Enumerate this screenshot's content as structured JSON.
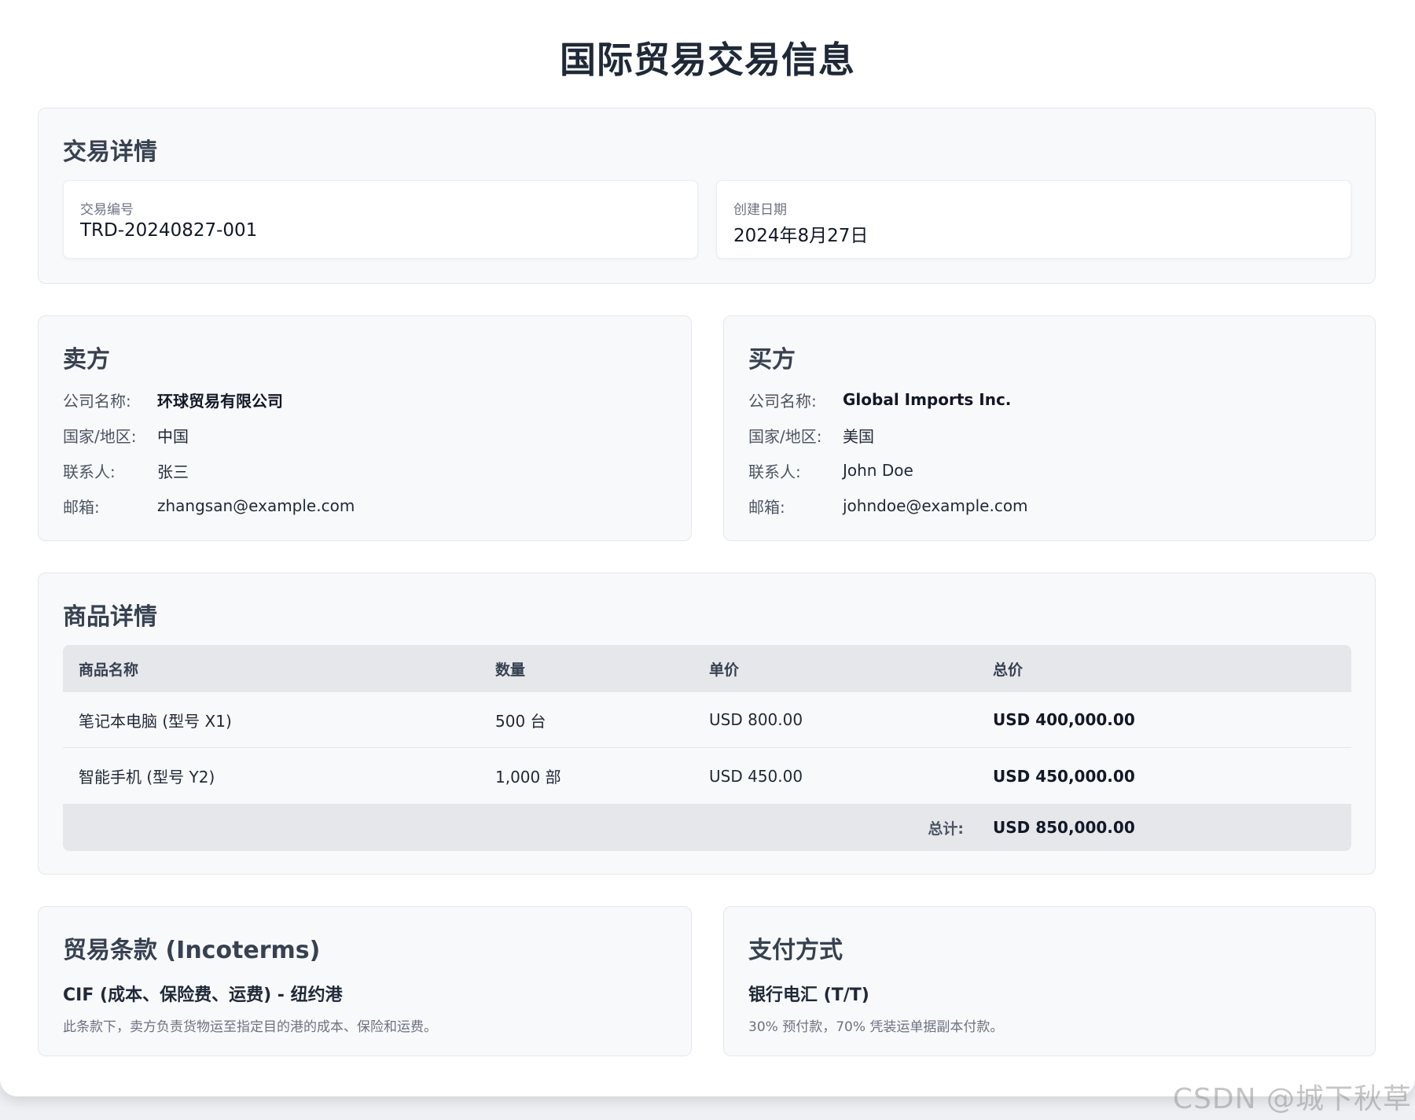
{
  "page_title": "国际贸易交易信息",
  "transaction": {
    "section_title": "交易详情",
    "id_label": "交易编号",
    "id_value": "TRD-20240827-001",
    "date_label": "创建日期",
    "date_value": "2024年8月27日"
  },
  "seller": {
    "section_title": "卖方",
    "rows": [
      {
        "label": "公司名称:",
        "value": "环球贸易有限公司"
      },
      {
        "label": "国家/地区:",
        "value": "中国"
      },
      {
        "label": "联系人:",
        "value": "张三"
      },
      {
        "label": "邮箱:",
        "value": "zhangsan@example.com"
      }
    ]
  },
  "buyer": {
    "section_title": "买方",
    "rows": [
      {
        "label": "公司名称:",
        "value": "Global Imports Inc."
      },
      {
        "label": "国家/地区:",
        "value": "美国"
      },
      {
        "label": "联系人:",
        "value": "John Doe"
      },
      {
        "label": "邮箱:",
        "value": "johndoe@example.com"
      }
    ]
  },
  "products": {
    "section_title": "商品详情",
    "columns": [
      "商品名称",
      "数量",
      "单价",
      "总价"
    ],
    "rows": [
      [
        "笔记本电脑 (型号 X1)",
        "500 台",
        "USD 800.00",
        "USD 400,000.00"
      ],
      [
        "智能手机 (型号 Y2)",
        "1,000 部",
        "USD 450.00",
        "USD 450,000.00"
      ]
    ],
    "total_label": "总计:",
    "total_value": "USD 850,000.00"
  },
  "terms": {
    "section_title": "贸易条款 (Incoterms)",
    "main": "CIF (成本、保险费、运费) - 纽约港",
    "description": "此条款下，卖方负责货物运至指定目的港的成本、保险和运费。"
  },
  "payment": {
    "section_title": "支付方式",
    "main": "银行电汇 (T/T)",
    "description": "30% 预付款，70% 凭装运单据副本付款。"
  },
  "watermark": "CSDN @城下秋草"
}
